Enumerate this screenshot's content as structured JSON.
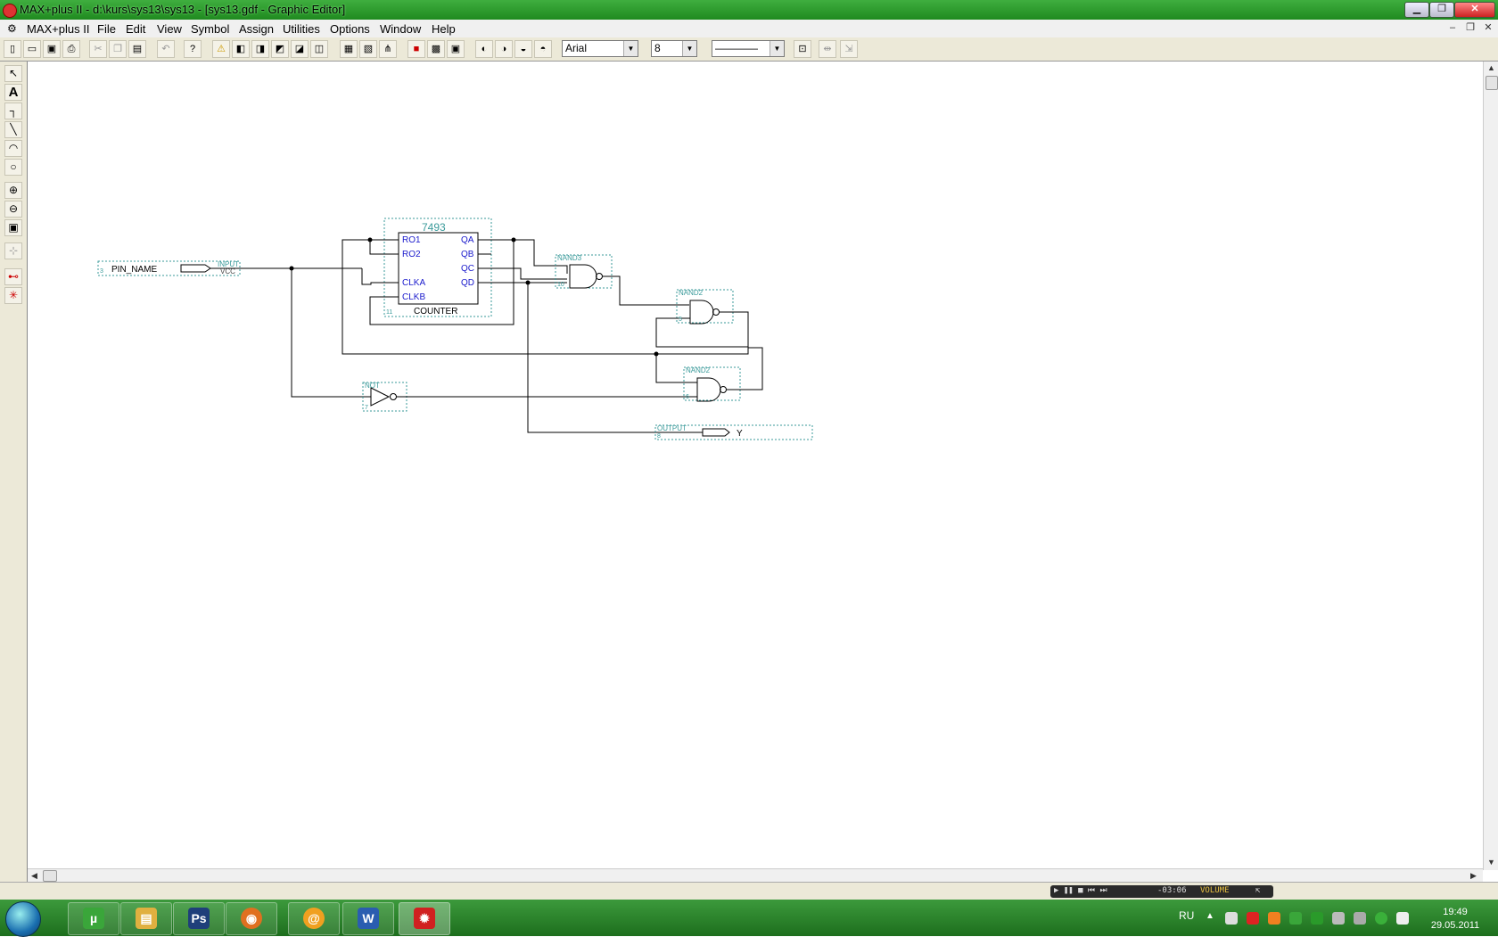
{
  "window": {
    "title": "MAX+plus II - d:\\kurs\\sys13\\sys13 - [sys13.gdf - Graphic Editor]",
    "buttons": {
      "minimize": "▁",
      "restore": "❐",
      "close": "✕"
    }
  },
  "menu": {
    "app_label": "MAX+plus II",
    "items": [
      "File",
      "Edit",
      "View",
      "Symbol",
      "Assign",
      "Utilities",
      "Options",
      "Window",
      "Help"
    ],
    "mdi_buttons": {
      "minimize": "–",
      "restore": "❐",
      "close": "✕"
    }
  },
  "toolbar": {
    "font_value": "Arial",
    "size_value": "8",
    "line_style_value": "————"
  },
  "schematic": {
    "input_pin": {
      "name": "PIN_NAME",
      "type": "INPUT",
      "default": "VCC",
      "number": "3"
    },
    "counter": {
      "part": "7493",
      "label": "COUNTER",
      "number": "11",
      "inputs": [
        "RO1",
        "RO2",
        "CLKA",
        "CLKB"
      ],
      "outputs": [
        "QA",
        "QB",
        "QC",
        "QD"
      ]
    },
    "nand3": {
      "type": "NAND3",
      "number": "10"
    },
    "nand2_a": {
      "type": "NAND2",
      "number": "5"
    },
    "nand2_b": {
      "type": "NAND2",
      "number": "6"
    },
    "not_gate": {
      "type": "NOT",
      "number": "7"
    },
    "output_pin": {
      "name": "Y",
      "type": "OUTPUT",
      "number": "8"
    }
  },
  "status": {
    "media_time": "-03:06",
    "media_label": "VOLUME"
  },
  "taskbar": {
    "apps": [
      {
        "name": "utorrent",
        "glyph": "µ",
        "color": "#3aa63a"
      },
      {
        "name": "explorer",
        "glyph": "▤",
        "color": "#e0b040"
      },
      {
        "name": "photoshop",
        "glyph": "Ps",
        "color": "#1f3f7a"
      },
      {
        "name": "firefox",
        "glyph": "◉",
        "color": "#e07020"
      },
      {
        "name": "mail-agent",
        "glyph": "@",
        "color": "#f0a020"
      },
      {
        "name": "word",
        "glyph": "W",
        "color": "#2a5db0"
      },
      {
        "name": "maxplus",
        "glyph": "✹",
        "color": "#d02020"
      }
    ],
    "language": "RU",
    "time": "19:49",
    "date": "29.05.2011"
  }
}
